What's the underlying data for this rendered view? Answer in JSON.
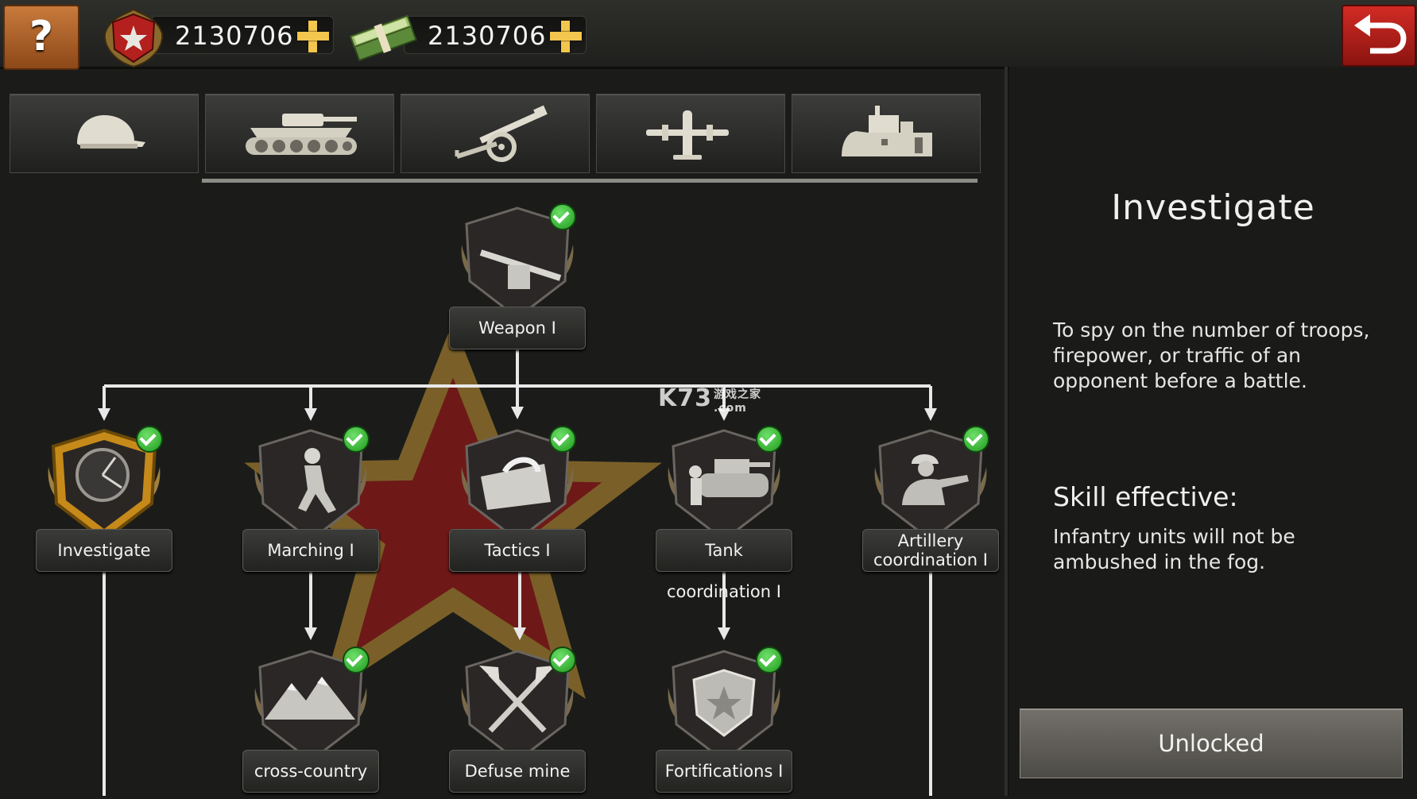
{
  "topbar": {
    "help_label": "?",
    "medals_value": "2130706",
    "cash_value": "2130706"
  },
  "tabs": [
    {
      "icon": "helmet-icon",
      "selected": false
    },
    {
      "icon": "tank-icon",
      "selected": true
    },
    {
      "icon": "artillery-icon",
      "selected": true
    },
    {
      "icon": "airplane-icon",
      "selected": true
    },
    {
      "icon": "warship-icon",
      "selected": true
    }
  ],
  "skills": {
    "weapon": {
      "label": "Weapon Ⅰ",
      "unlocked": true
    },
    "investigate": {
      "label": "Investigate",
      "unlocked": true,
      "selected": true
    },
    "marching": {
      "label": "Marching Ⅰ",
      "unlocked": true
    },
    "tactics": {
      "label": "Tactics Ⅰ",
      "unlocked": true
    },
    "tank_coordination": {
      "label": "Tank coordination Ⅰ",
      "unlocked": true
    },
    "artillery_coordination": {
      "label_line1": "Artillery",
      "label_line2": "coordination Ⅰ",
      "unlocked": true
    },
    "cross_country": {
      "label": "cross-country",
      "unlocked": true
    },
    "defuse_mine": {
      "label": "Defuse mine",
      "unlocked": true
    },
    "fortifications": {
      "label": "Fortifications Ⅰ",
      "unlocked": true
    }
  },
  "detail": {
    "title": "Investigate",
    "description": "To spy on the number of troops, firepower, or traffic of an opponent before a battle.",
    "effect_heading": "Skill effective:",
    "effect_text": "Infantry units will not be ambushed in the fog.",
    "status_button": "Unlocked"
  },
  "watermark": {
    "main": "K73",
    "sub1": "游戏之家",
    "sub2": ".com"
  },
  "colors": {
    "accent_gold": "#f3c64d",
    "help_orange": "#c87a3c",
    "back_red": "#d12b24",
    "check_green": "#3fbf3a",
    "star_red": "#7a1a18",
    "star_gold": "#7a6028"
  }
}
